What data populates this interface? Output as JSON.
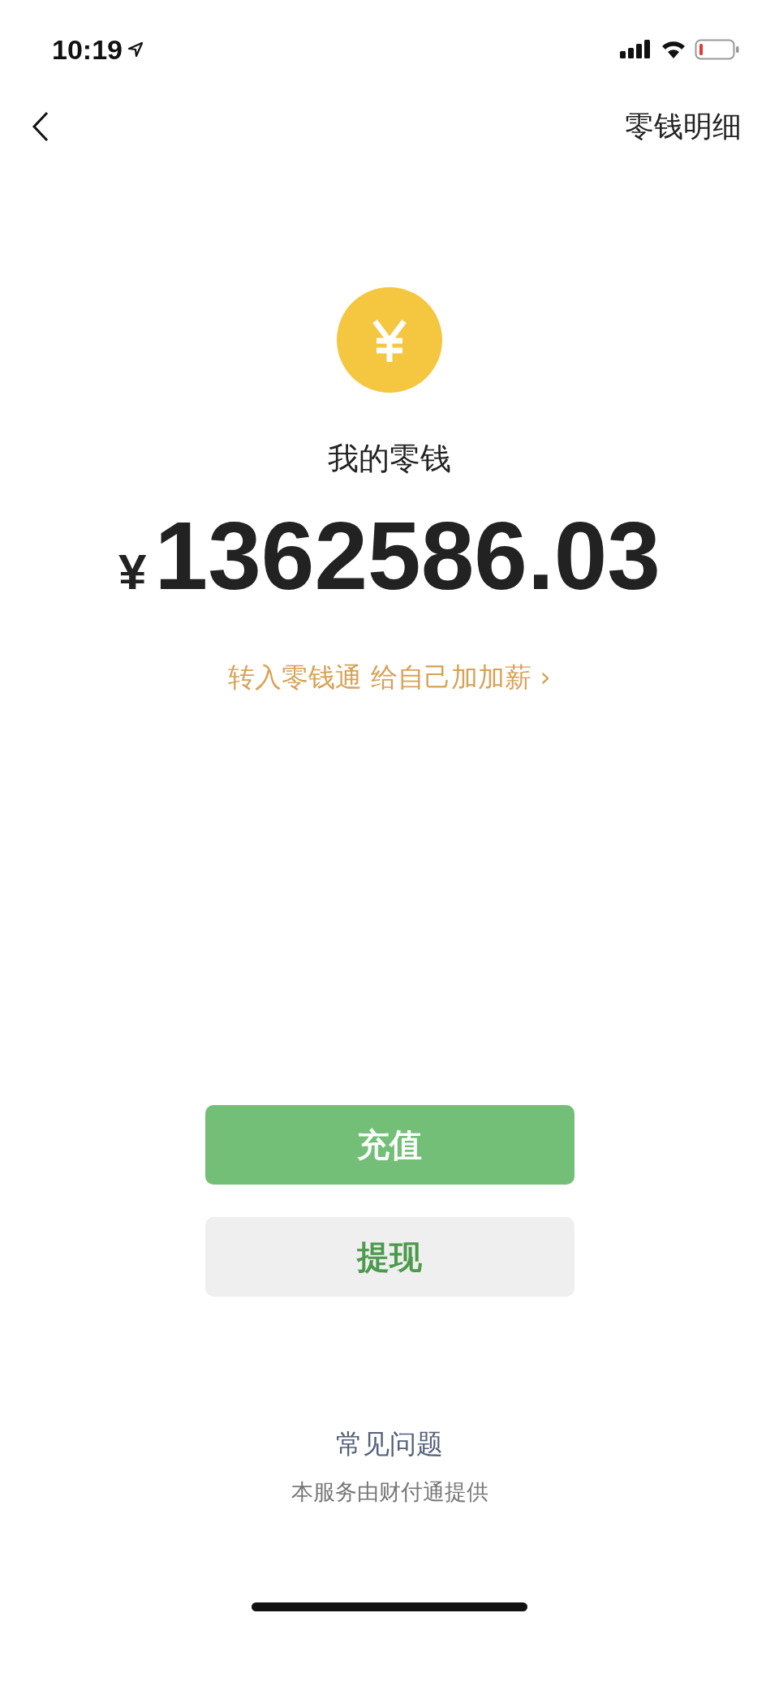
{
  "status_bar": {
    "time": "10:19"
  },
  "header": {
    "action": "零钱明细"
  },
  "balance": {
    "label": "我的零钱",
    "currency": "¥",
    "amount": "1362586.03"
  },
  "promo_link": "转入零钱通 给自己加加薪 ›",
  "buttons": [
    {
      "label": "充值",
      "kind": "primary"
    },
    {
      "label": "提现",
      "kind": "secondary"
    }
  ],
  "footer": {
    "faq": "常见问题",
    "provider": "本服务由财付通提供"
  }
}
